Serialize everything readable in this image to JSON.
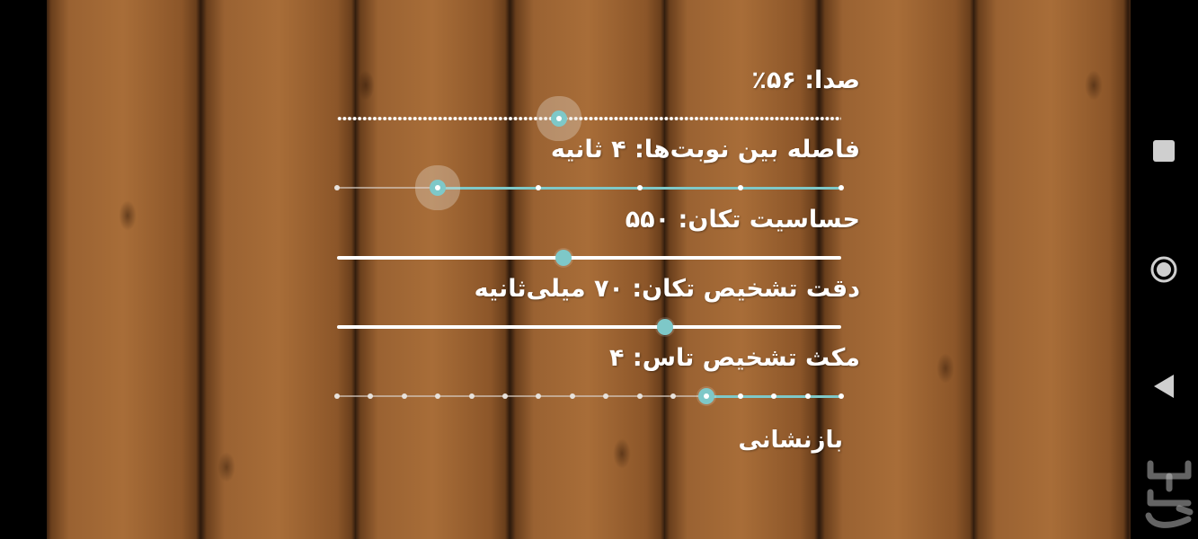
{
  "settings": {
    "volume": {
      "label": "صدا: ۵۶٪",
      "value_fraction": 0.44,
      "style": "dotted"
    },
    "turn_interval": {
      "label": "فاصله بین نوبت‌ها: ۴ ثانیه",
      "value_fraction": 0.2,
      "steps": 5,
      "style": "discrete"
    },
    "shake_sensitivity": {
      "label": "حساسیت تکان: ۵۵۰",
      "value_fraction": 0.45,
      "style": "solid"
    },
    "shake_accuracy": {
      "label": "دقت تشخیص تکان: ۷۰ میلی‌ثانیه",
      "value_fraction": 0.65,
      "style": "solid"
    },
    "dice_pause": {
      "label": "مکث تشخیص تاس: ۴",
      "value_fraction": 0.733,
      "steps": 15,
      "style": "discrete"
    }
  },
  "reset_label": "بازنشانی",
  "watermark_text": "بازار",
  "colors": {
    "accent": "#7ec8c8",
    "text": "#ffffff",
    "wood": "#8a5628"
  },
  "nav": {
    "recents_icon": "square-icon",
    "home_icon": "circle-icon",
    "back_icon": "triangle-back-icon"
  }
}
